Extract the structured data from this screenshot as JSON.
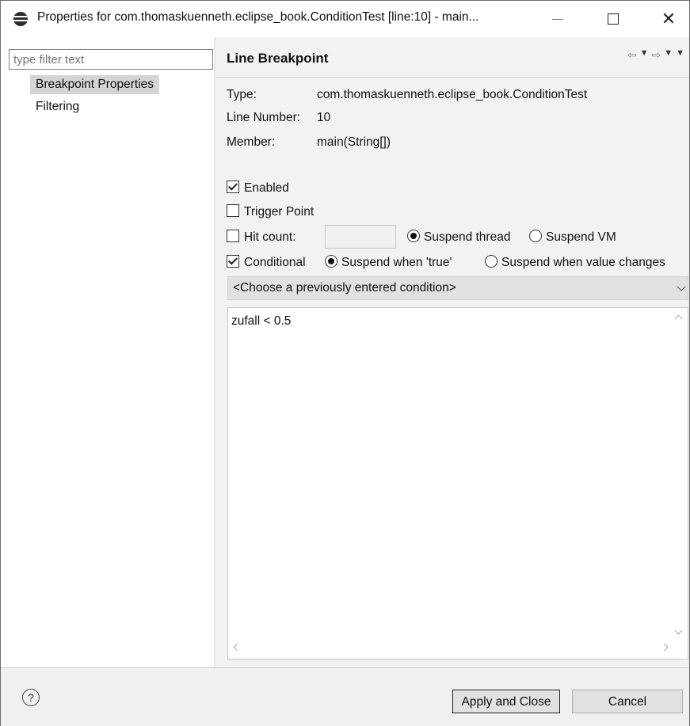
{
  "window": {
    "title": "Properties for com.thomaskuenneth.eclipse_book.ConditionTest [line:10] - main..."
  },
  "sidebar": {
    "filter_placeholder": "type filter text",
    "items": [
      {
        "label": "Breakpoint Properties",
        "selected": true
      },
      {
        "label": "Filtering",
        "selected": false
      }
    ]
  },
  "page": {
    "title": "Line Breakpoint",
    "type_label": "Type:",
    "type_value": "com.thomaskuenneth.eclipse_book.ConditionTest",
    "line_label": "Line Number:",
    "line_value": "10",
    "member_label": "Member:",
    "member_value": "main(String[])",
    "enabled_label": "Enabled",
    "enabled_checked": true,
    "trigger_label": "Trigger Point",
    "trigger_checked": false,
    "hitcount_label": "Hit count:",
    "hitcount_checked": false,
    "hitcount_value": "",
    "suspend_thread_label": "Suspend thread",
    "suspend_vm_label": "Suspend VM",
    "conditional_label": "Conditional",
    "conditional_checked": true,
    "suspend_true_label": "Suspend when 'true'",
    "suspend_changes_label": "Suspend when value changes",
    "condition_combo": "<Choose a previously entered condition>",
    "condition_text": "zufall < 0.5"
  },
  "footer": {
    "help_label": "?",
    "apply_label": "Apply and Close",
    "cancel_label": "Cancel"
  }
}
